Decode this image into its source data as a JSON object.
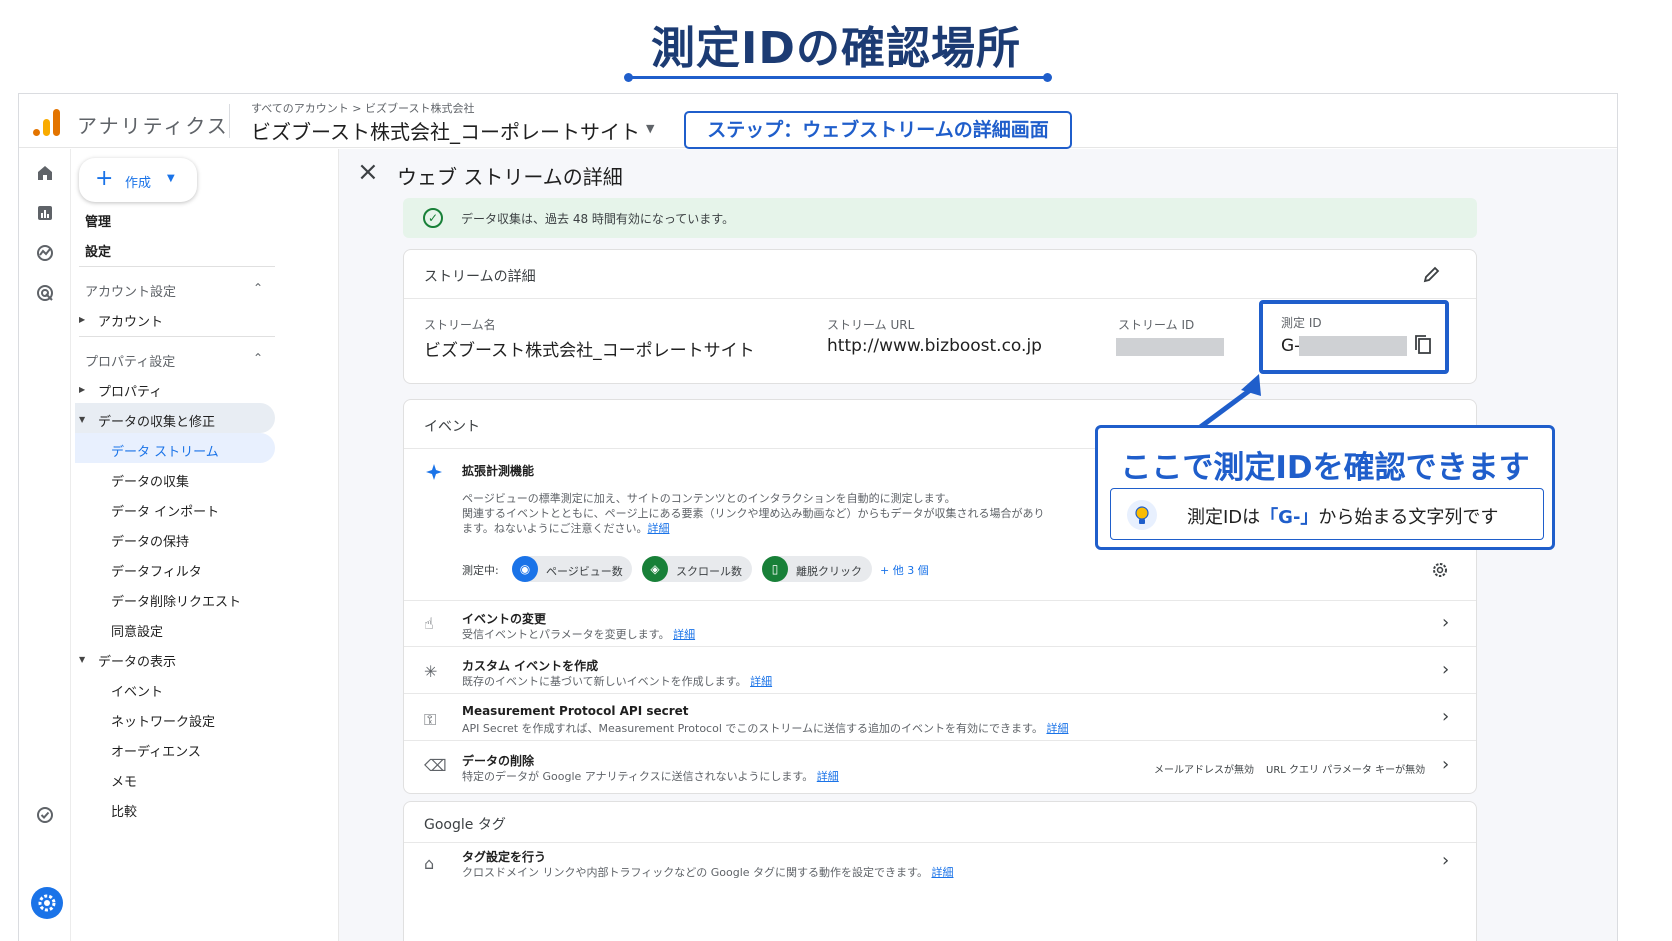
{
  "page": {
    "title": "測定IDの確認場所",
    "step_label": "ステップ：ウェブストリームの詳細画面"
  },
  "header": {
    "app_name": "アナリティクス",
    "breadcrumb": "すべてのアカウント > ビズブースト株式会社",
    "property": "ビズブースト株式会社_コーポレートサイト"
  },
  "nav": {
    "create": "作成",
    "items": [
      "管理",
      "設定",
      "アカウント設定",
      "アカウント",
      "プロパティ設定",
      "プロパティ",
      "データの収集と修正",
      "データ ストリーム",
      "データの収集",
      "データ インポート",
      "データの保持",
      "データフィルタ",
      "データ削除リクエスト",
      "同意設定",
      "データの表示",
      "イベント",
      "ネットワーク設定",
      "オーディエンス",
      "メモ",
      "比較"
    ]
  },
  "main": {
    "title": "ウェブ ストリームの詳細",
    "banner": "データ収集は、過去 48 時間有効になっています。",
    "stream": {
      "section": "ストリームの詳細",
      "name_label": "ストリーム名",
      "name_value": "ビズブースト株式会社_コーポレートサイト",
      "url_label": "ストリーム URL",
      "url_value": "http://www.bizboost.co.jp",
      "id_label": "ストリーム ID",
      "mid_label": "測定 ID",
      "mid_prefix": "G-"
    },
    "events": {
      "section": "イベント",
      "enhanced_title": "拡張計測機能",
      "enhanced_desc1": "ページビューの標準測定に加え、サイトのコンテンツとのインタラクションを自動的に測定します。",
      "enhanced_desc2": "関連するイベントとともに、ページ上にある要素（リンクや埋め込み動画など）からもデータが収集される場合があり",
      "enhanced_desc3": "ます。ねないようにご注意ください。",
      "detail_link": "詳細",
      "measuring": "測定中:",
      "chip1": "ページビュー数",
      "chip2": "スクロール数",
      "chip3": "離脱クリック",
      "more": "+ 他 3 個",
      "rows": [
        {
          "title": "イベントの変更",
          "desc": "受信イベントとパラメータを変更します。"
        },
        {
          "title": "カスタム イベントを作成",
          "desc": "既存のイベントに基づいて新しいイベントを作成します。"
        },
        {
          "title": "Measurement Protocol API secret",
          "desc": "API Secret を作成すれば、Measurement Protocol でこのストリームに送信する追加のイベントを有効にできます。"
        },
        {
          "title": "データの削除",
          "desc": "特定のデータが Google アナリティクスに送信されないようにします。"
        }
      ],
      "tag_email": "メールアドレスが無効",
      "tag_url": "URL クエリ パラメータ キーが無効"
    },
    "gtag": {
      "section": "Google タグ",
      "row_title": "タグ設定を行う",
      "row_desc": "クロスドメイン リンクや内部トラフィックなどの Google タグに関する動作を設定できます。"
    }
  },
  "callout": {
    "head": "ここで測定IDを確認できます",
    "note_pre": "測定IDは",
    "note_key": "「G-」",
    "note_post": "から始まる文字列です"
  },
  "colors": {
    "accent": "#1f5ecb",
    "ga_orange": "#e37400",
    "ga_yellow": "#f9ab00",
    "link": "#1a73e8"
  }
}
